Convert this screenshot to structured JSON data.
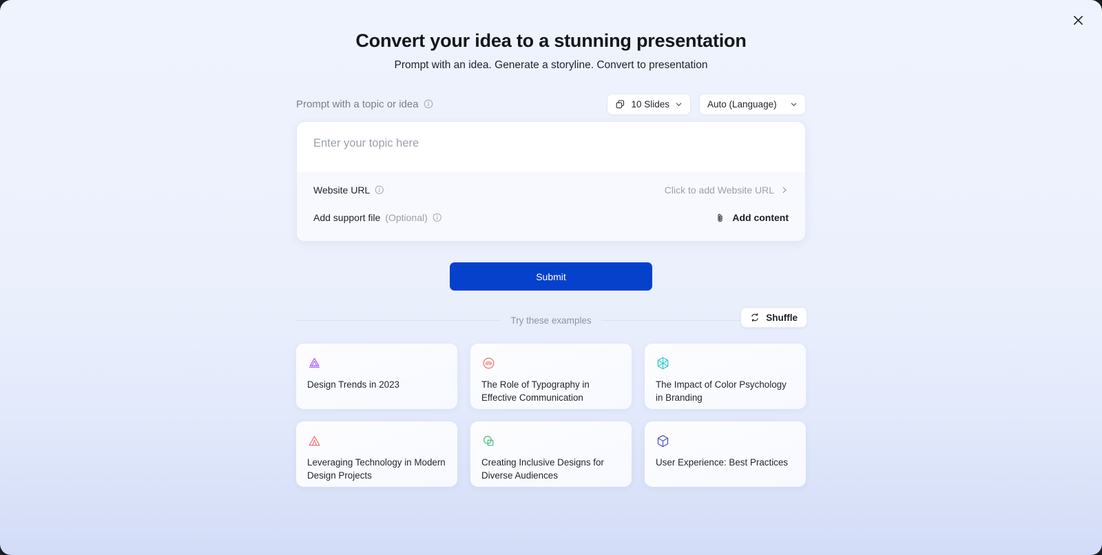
{
  "window": {
    "close_label": "×"
  },
  "header": {
    "title": "Convert your idea to a stunning presentation",
    "subtitle": "Prompt with an idea. Generate a storyline. Convert to presentation"
  },
  "prompt": {
    "label": "Prompt with a topic or idea",
    "info_icon": "info-icon",
    "placeholder": "Enter your topic here",
    "value": ""
  },
  "controls": {
    "slides": {
      "icon": "copy-slides-icon",
      "value": "10 Slides",
      "chevron": "chevron-down-icon"
    },
    "language": {
      "value": "Auto (Language)",
      "chevron": "chevron-down-icon"
    }
  },
  "options": {
    "website": {
      "label": "Website URL",
      "info_icon": "info-icon",
      "action_label": "Click to add Website URL",
      "action_icon": "chevron-right-icon"
    },
    "support_file": {
      "label": "Add support file",
      "optional_label": "(Optional)",
      "info_icon": "info-icon",
      "action_label": "Add content",
      "action_icon": "paperclip-icon"
    }
  },
  "submit": {
    "label": "Submit",
    "color": "#0641cc"
  },
  "examples": {
    "divider_label": "Try these examples",
    "shuffle_label": "Shuffle",
    "shuffle_icon": "shuffle-icon",
    "cards": [
      {
        "icon": "triangle-lamp-icon",
        "color": "#a855f7",
        "text": "Design Trends in 2023"
      },
      {
        "icon": "spiral-circle-icon",
        "color": "#f4706a",
        "text": "The Role of Typography in Effective Communication"
      },
      {
        "icon": "hexagon-cube-icon",
        "color": "#2ec8d3",
        "text": "The Impact of Color Psychology in Branding"
      },
      {
        "icon": "triangle-alert-icon",
        "color": "#f4706a",
        "text": "Leveraging Technology in Modern Design Projects"
      },
      {
        "icon": "overlap-shapes-icon",
        "color": "#46be7d",
        "text": "Creating Inclusive Designs for Diverse Audiences"
      },
      {
        "icon": "cube-outline-icon",
        "color": "#4b52c4",
        "text": "User Experience: Best Practices"
      }
    ]
  }
}
